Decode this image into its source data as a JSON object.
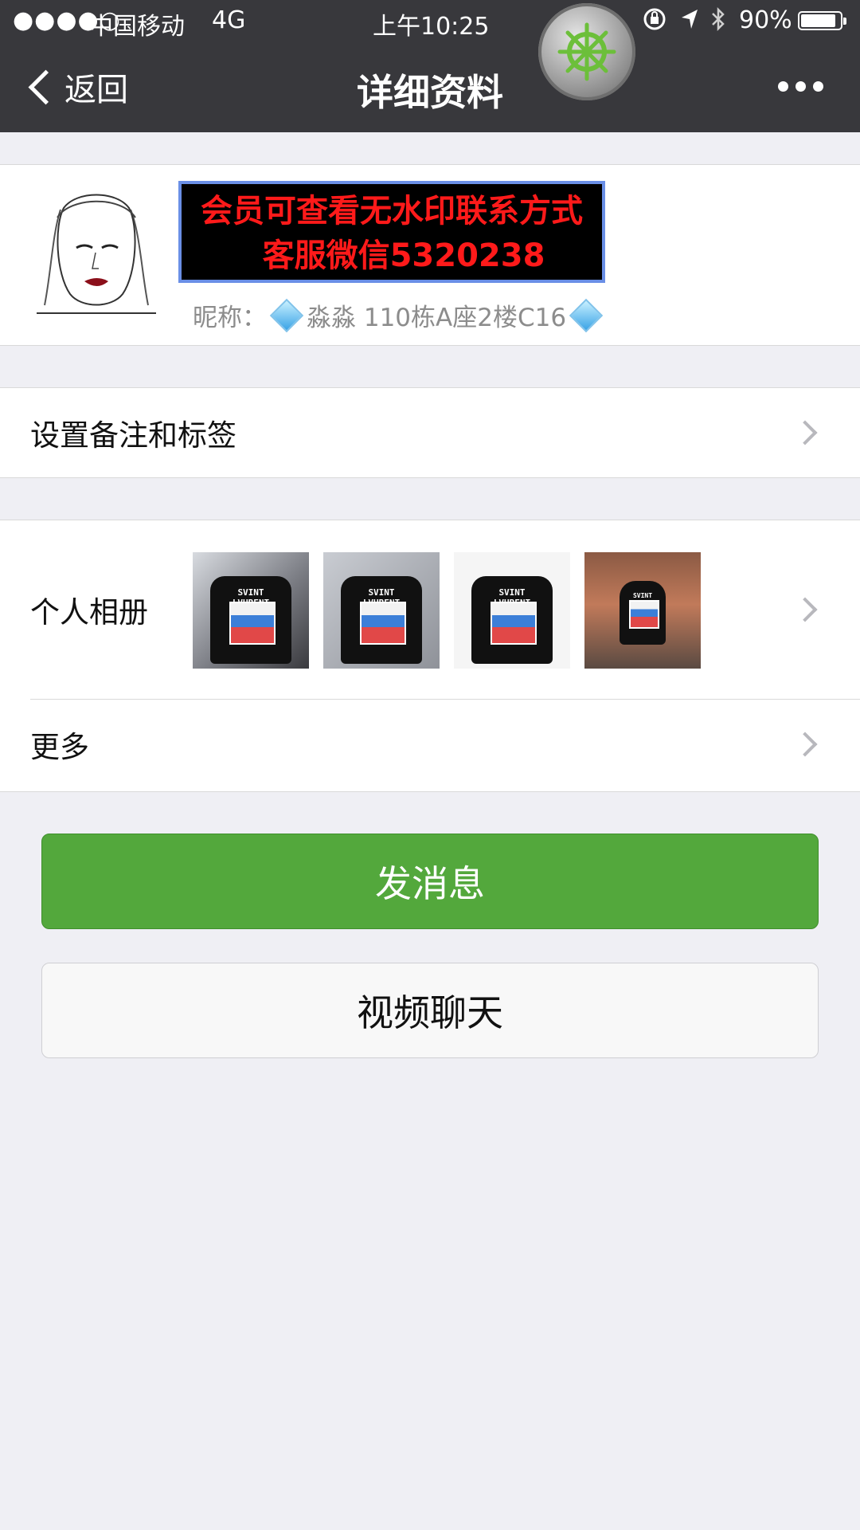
{
  "status_bar": {
    "signal": "●●●●○",
    "carrier": "中国移动",
    "network": "4G",
    "time": "上午10:25",
    "battery_percent": "90%",
    "battery_level": 0.9
  },
  "nav": {
    "back_label": "返回",
    "title": "详细资料"
  },
  "profile": {
    "banner_line1": "会员可查看无水印联系方式",
    "banner_line2": "客服微信5320238",
    "nickname_label": "昵称：",
    "nickname_value": "淼淼 110栋A座2楼C16"
  },
  "rows": {
    "remark_label": "设置备注和标签",
    "album_label": "个人相册",
    "more_label": "更多"
  },
  "album": {
    "thumbnails": [
      {
        "brand_text": "SVINT LVURENT"
      },
      {
        "brand_text": "SVINT LVURENT"
      },
      {
        "brand_text": "SVINT LVURENT"
      },
      {
        "brand_text": "SVINT LVURENT"
      }
    ]
  },
  "buttons": {
    "send_message": "发消息",
    "video_chat": "视频聊天"
  },
  "colors": {
    "nav_bg": "#38383c",
    "send_button": "#53a83c",
    "page_bg": "#efeff4",
    "banner_text": "#ff1a1a"
  },
  "icons": [
    "chevron-left-icon",
    "more-dots-icon",
    "helm-icon",
    "diamond-icon",
    "chevron-right-icon",
    "location-arrow-icon",
    "bluetooth-icon",
    "rotation-lock-icon",
    "battery-icon"
  ]
}
